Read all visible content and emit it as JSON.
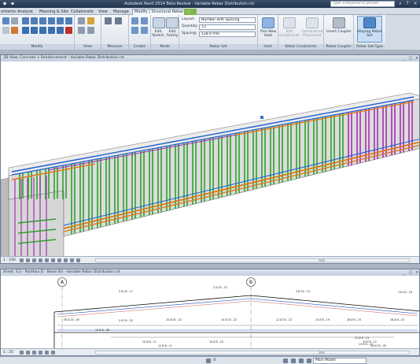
{
  "window": {
    "title": "Autodesk Revit 2014 Beta Review - Variable Rebar Distribution.rvt",
    "search_placeholder": "Type a keyword or phrase"
  },
  "tabs": [
    {
      "label": "ontents"
    },
    {
      "label": "Analyze"
    },
    {
      "label": "Massing & Site"
    },
    {
      "label": "Collaborate"
    },
    {
      "label": "View"
    },
    {
      "label": "Manage"
    },
    {
      "label": "Modify | Structural Rebar"
    }
  ],
  "ribbon": {
    "groups": {
      "modify": "Modify",
      "view": "View",
      "measure": "Measure",
      "create": "Create",
      "mode": "Mode",
      "rebar_set": "Rebar Set",
      "host": "Host",
      "rebar_constraints": "Rebar Constraints",
      "rebar_coupler": "Rebar Coupler",
      "rebar_set_type": "Rebar Set Type"
    },
    "edit_sketch": "Edit Sketch",
    "edit_family": "Edit Family",
    "layout_label": "Layout:",
    "layout_value": "Number with Spacing",
    "quantity_label": "Quantity:",
    "quantity_value": "13",
    "spacing_label": "Spacing:",
    "spacing_value": "128.0 mm",
    "pick_new_host": "Pick New Host",
    "edit_constraints": "Edit Constraints",
    "constrained_placement": "Constrained Placement",
    "insert_coupler": "Insert Coupler",
    "varying_rebar_set": "Varying Rebar Set"
  },
  "view1": {
    "title": "3D View: Concrete + Reinforcement - Variable Rebar Distribution.rvt",
    "scale": "1 : 100"
  },
  "view2": {
    "title": "Sheet: S.2 - Partition D - Beam B3 - Variable Rebar Distribution.rvt",
    "scale": "1 : 25",
    "grid_a": "A",
    "grid_b": "B",
    "labels": [
      "5 Ø 20 - 17",
      "2 Ø 20 - 15",
      "3 Ø 20 - 14",
      "3 Ø 20 - 18",
      "30 Ø 20 - 05",
      "2 Ø 20 - 20",
      "10 Ø 20 - 22",
      "10 Ø 20 - 22",
      "12 Ø 20 - 22",
      "14 Ø 8 - 19",
      "16 Ø 8 - 23",
      "16 Ø 8 - 23",
      "10 Ø 8 - 11",
      "14 Ø 8 - 11",
      "10 Ø 8 - 10",
      "13 Ø 8 - 12",
      "30 Ø 20 - 05"
    ],
    "stirrup_labels": [
      "15 Ø 8 - 14",
      "13 Ø 8 - 13",
      "12 Ø 8 - 08"
    ]
  },
  "status": {
    "coord": ":0",
    "model": "Main Model"
  }
}
